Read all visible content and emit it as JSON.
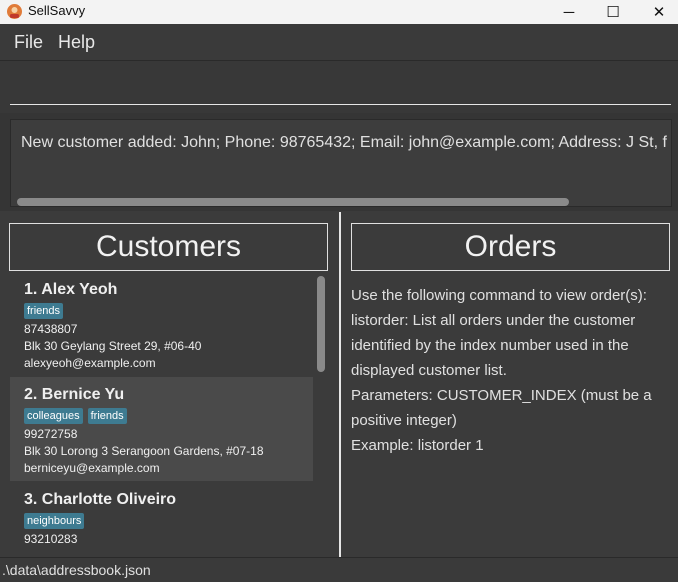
{
  "window": {
    "title": "SellSavvy",
    "minimize": "─",
    "maximize": "☐",
    "close": "✕"
  },
  "menu": {
    "file": "File",
    "help": "Help"
  },
  "command": {
    "value": ""
  },
  "result": {
    "text": "New customer added: John; Phone: 98765432; Email: john@example.com; Address: J St, f"
  },
  "customers": {
    "title": "Customers",
    "items": [
      {
        "name": "1. Alex Yeoh",
        "tags": [
          "friends"
        ],
        "phone": "87438807",
        "address": "Blk 30 Geylang Street 29, #06-40",
        "email": "alexyeoh@example.com"
      },
      {
        "name": "2. Bernice Yu",
        "tags": [
          "colleagues",
          "friends"
        ],
        "phone": "99272758",
        "address": "Blk 30 Lorong 3 Serangoon Gardens, #07-18",
        "email": "berniceyu@example.com"
      },
      {
        "name": "3. Charlotte Oliveiro",
        "tags": [
          "neighbours"
        ],
        "phone": "93210283",
        "address": "",
        "email": ""
      }
    ]
  },
  "orders": {
    "title": "Orders",
    "lines": [
      "Use the following command to view order(s):",
      "listorder: List all orders under the customer",
      "identified by the index number used in the",
      "displayed customer list.",
      "Parameters: CUSTOMER_INDEX (must be a",
      "positive integer)",
      "Example: listorder 1"
    ]
  },
  "status": {
    "path": ".\\data\\addressbook.json"
  },
  "colors": {
    "tag": "#3e7b91",
    "selected_card": "#4a4a4a",
    "card": "#3b3b3b"
  }
}
